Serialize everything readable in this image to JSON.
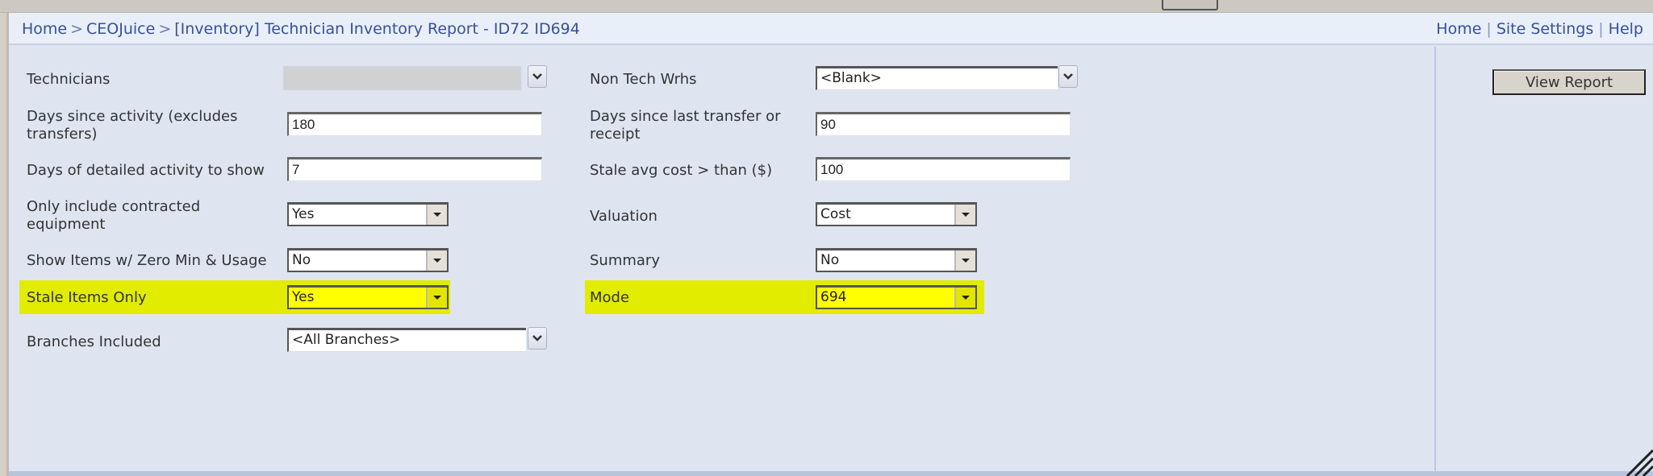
{
  "header": {
    "breadcrumb": [
      "Home",
      "CEOJuice",
      "[Inventory] Technician Inventory Report - ID72 ID694"
    ],
    "breadcrumb_separator": ">",
    "top_links": [
      "Home",
      "Site Settings",
      "Help"
    ],
    "top_link_separator": "|"
  },
  "params": {
    "technicians": {
      "label": "Technicians",
      "value": ""
    },
    "non_tech_wrhs": {
      "label": "Non Tech Wrhs",
      "value": "<Blank>"
    },
    "days_since_activity": {
      "label_line1": "Days since activity (excludes",
      "label_line2": "transfers)",
      "value": "180"
    },
    "days_since_transfer": {
      "label_line1": "Days since last transfer or",
      "label_line2": "receipt",
      "value": "90"
    },
    "days_detailed": {
      "label": "Days of detailed activity to show",
      "value": "7"
    },
    "stale_avg_cost": {
      "label": "Stale avg cost > than ($)",
      "value": "100"
    },
    "contracted": {
      "label_line1": "Only include contracted",
      "label_line2": "equipment",
      "value": "Yes"
    },
    "valuation": {
      "label": "Valuation",
      "value": "Cost"
    },
    "zero_min_usage": {
      "label": "Show Items w/ Zero Min & Usage",
      "value": "No"
    },
    "summary": {
      "label": "Summary",
      "value": "No"
    },
    "stale_items_only": {
      "label": "Stale Items Only",
      "value": "Yes",
      "highlighted": true
    },
    "mode": {
      "label": "Mode",
      "value": "694",
      "highlighted": true
    },
    "branches": {
      "label": "Branches Included",
      "value": "<All Branches>"
    }
  },
  "actions": {
    "view_report": "View Report"
  },
  "colors": {
    "highlight": "#e2ec00",
    "link": "#3a4f9a",
    "panel_bg": "#dfe5f0"
  }
}
